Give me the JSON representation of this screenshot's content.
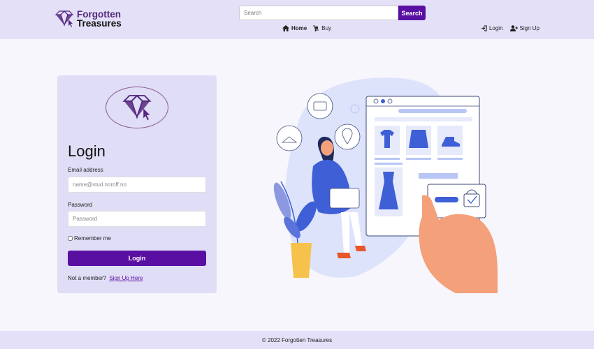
{
  "header": {
    "logo": {
      "line1": "Forgotten",
      "line2": "Treasures"
    },
    "search": {
      "placeholder": "Search",
      "button_label": "Search"
    },
    "nav": [
      {
        "label": "Home",
        "icon": "home-icon",
        "active": true
      },
      {
        "label": "Buy",
        "icon": "dolly-icon",
        "active": false
      }
    ],
    "auth": [
      {
        "label": "Login",
        "icon": "sign-in-icon"
      },
      {
        "label": "Sign Up",
        "icon": "user-plus-icon"
      }
    ]
  },
  "login": {
    "title": "Login",
    "email_label": "Email address",
    "email_placeholder": "name@stud.noroff.no",
    "password_label": "Password",
    "password_placeholder": "Password",
    "remember_label": "Remember me",
    "button_label": "Login",
    "member_text": "Not a member?",
    "signup_link": "Sign Up Here"
  },
  "footer": {
    "text": "© 2022 Forgotten Treasures"
  },
  "colors": {
    "accent": "#5a0fa3",
    "header_bg": "#e3e0f7",
    "card_bg": "#e0ddf6",
    "illustration_blue": "#3e5fd6"
  }
}
